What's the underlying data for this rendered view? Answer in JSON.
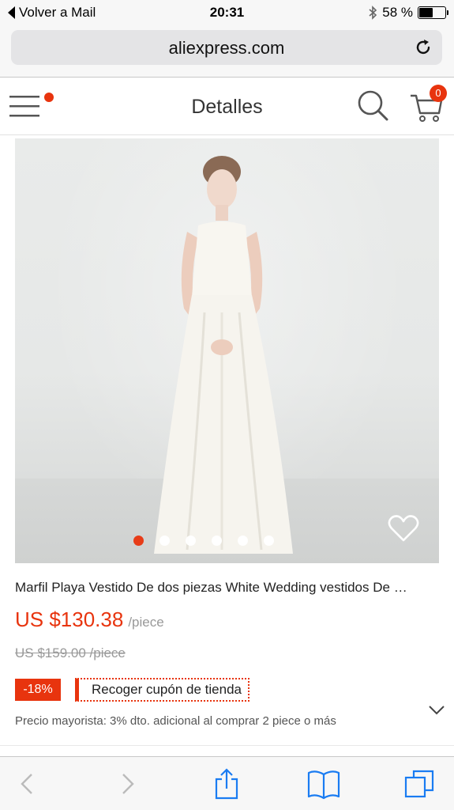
{
  "status_bar": {
    "back_label": "Volver a Mail",
    "time": "20:31",
    "battery_text": "58 %",
    "battery_level": 0.58
  },
  "browser": {
    "url": "aliexpress.com"
  },
  "header": {
    "title": "Detalles",
    "cart_count": "0",
    "accent_color": "#e8340e"
  },
  "gallery": {
    "image_count": 6,
    "active_index": 0
  },
  "product": {
    "title": "Marfil Playa Vestido De dos piezas White Wedding vestidos De …",
    "price": "US $130.38",
    "price_unit": "/piece",
    "old_price": "US $159.00 /piece",
    "discount": "-18%",
    "coupon_label": "Recoger cupón de tienda",
    "wholesale_text": "Precio mayorista: 3% dto. adicional al comprar 2 piece o más"
  },
  "toolbar": {
    "icons": [
      "back-icon",
      "forward-icon",
      "share-icon",
      "bookmarks-icon",
      "tabs-icon"
    ]
  }
}
